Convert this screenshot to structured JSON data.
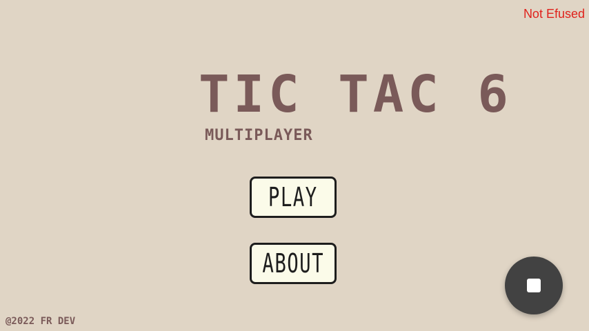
{
  "status_text": "Not Efused",
  "game": {
    "title": "TIC TAC 6",
    "subtitle": "MULTIPLAYER"
  },
  "menu": {
    "play_label": "PLAY",
    "about_label": "ABOUT"
  },
  "footer": {
    "copyright": "@2022 FR DEV"
  },
  "fab": {
    "icon": "stop-icon"
  },
  "colors": {
    "background": "#e0d5c5",
    "title": "#7a5a59",
    "button_fill": "#fbfbe9",
    "button_border": "#1d1d1d",
    "status": "#e0221c",
    "fab": "#424242"
  }
}
